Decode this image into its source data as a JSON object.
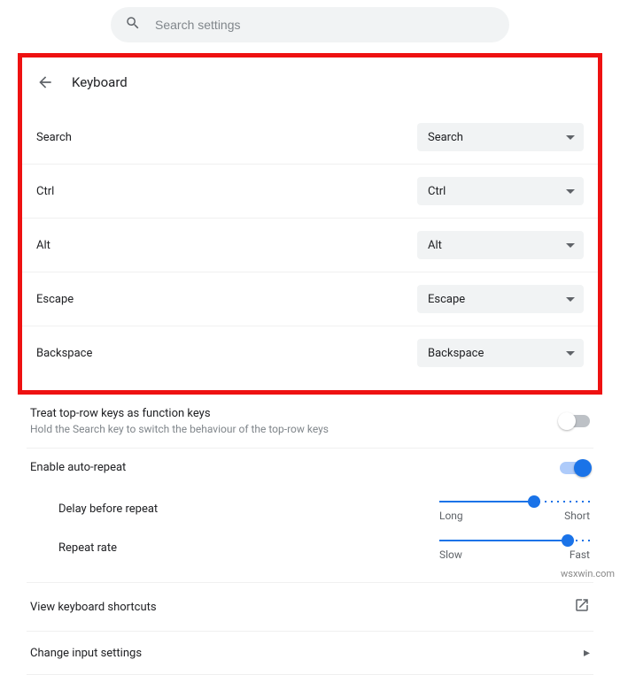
{
  "search": {
    "placeholder": "Search settings"
  },
  "header": {
    "title": "Keyboard"
  },
  "keymap": [
    {
      "label": "Search",
      "value": "Search"
    },
    {
      "label": "Ctrl",
      "value": "Ctrl"
    },
    {
      "label": "Alt",
      "value": "Alt"
    },
    {
      "label": "Escape",
      "value": "Escape"
    },
    {
      "label": "Backspace",
      "value": "Backspace"
    }
  ],
  "toprow": {
    "title": "Treat top-row keys as function keys",
    "subtitle": "Hold the Search key to switch the behaviour of the top-row keys",
    "enabled": false
  },
  "autorepeat": {
    "title": "Enable auto-repeat",
    "enabled": true,
    "delay": {
      "label": "Delay before repeat",
      "left": "Long",
      "right": "Short",
      "position": 63
    },
    "rate": {
      "label": "Repeat rate",
      "left": "Slow",
      "right": "Fast",
      "position": 85
    }
  },
  "links": {
    "shortcuts": "View keyboard shortcuts",
    "input": "Change input settings"
  },
  "watermark": "wsxwin.com"
}
